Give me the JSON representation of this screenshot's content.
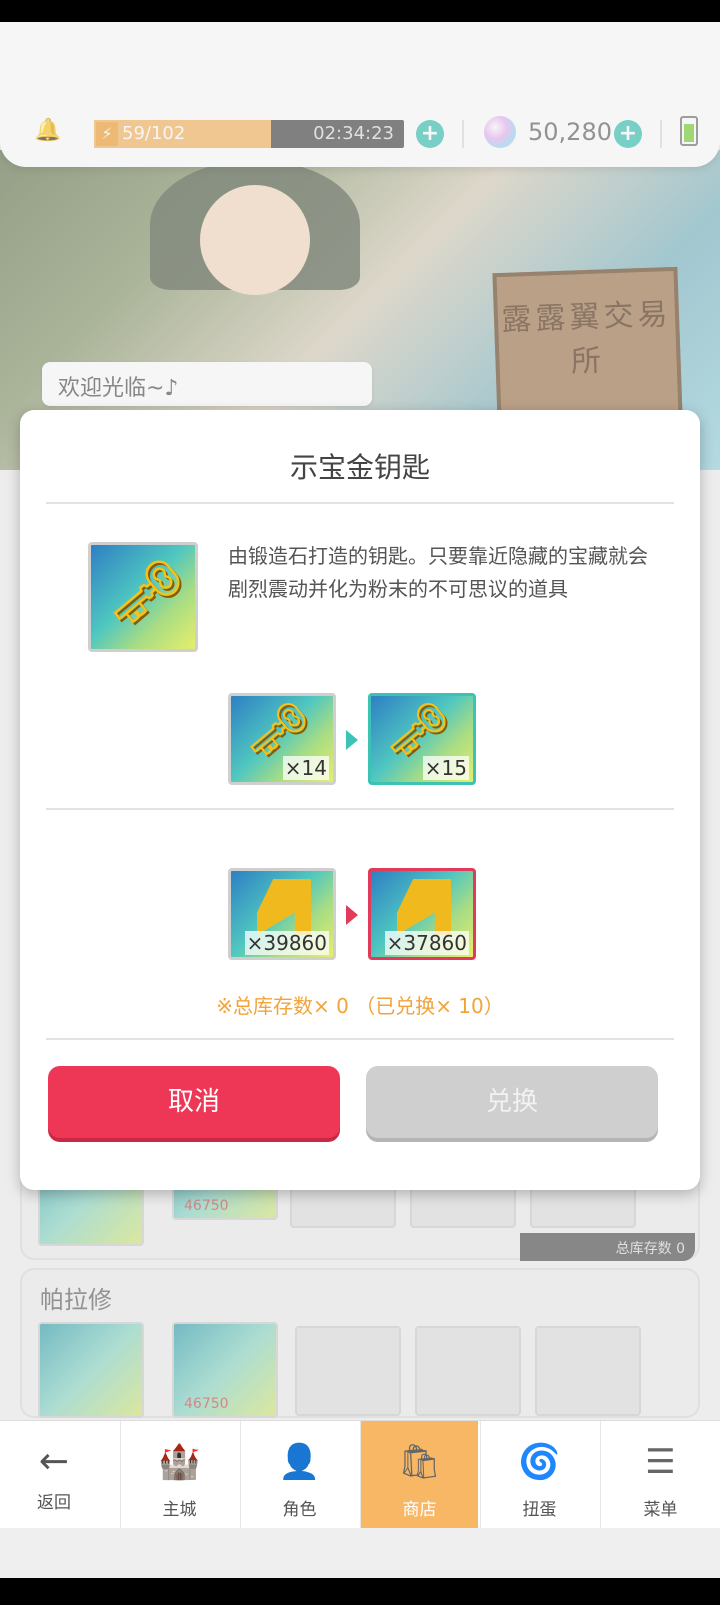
{
  "header": {
    "stamina_count": "59/102",
    "stamina_timer": "02:34:23",
    "stamina_fill_fraction": 0.57,
    "gems": "50,280"
  },
  "background": {
    "welcome_text": "欢迎光临~♪",
    "sign_text": "露露翼交易所"
  },
  "list": {
    "price_1": "46750",
    "price_2": "46750",
    "stock_tag": "总库存数 0",
    "section_name": "帕拉修"
  },
  "modal": {
    "title": "示宝金钥匙",
    "description": "由锻造石打造的钥匙。只要靠近隐藏的宝藏就会剧烈震动并化为粉末的不可思议的道具",
    "item_before_qty": "×14",
    "item_after_qty": "×15",
    "cost_before_qty": "×39860",
    "cost_after_qty": "×37860",
    "stock_note": "※总库存数× 0 （已兑换× 10）",
    "cancel_label": "取消",
    "exchange_label": "兑换"
  },
  "nav": {
    "back": "返回",
    "items": [
      {
        "label": "主城",
        "icon": "castle-icon"
      },
      {
        "label": "角色",
        "icon": "character-icon"
      },
      {
        "label": "商店",
        "icon": "shop-icon"
      },
      {
        "label": "扭蛋",
        "icon": "gacha-icon"
      },
      {
        "label": "菜单",
        "icon": "menu-icon"
      }
    ]
  },
  "colors": {
    "accent_red": "#ee3657",
    "accent_teal": "#3cc3b6",
    "stamina_orange": "#f7b765",
    "note_orange": "#f2a33a"
  }
}
